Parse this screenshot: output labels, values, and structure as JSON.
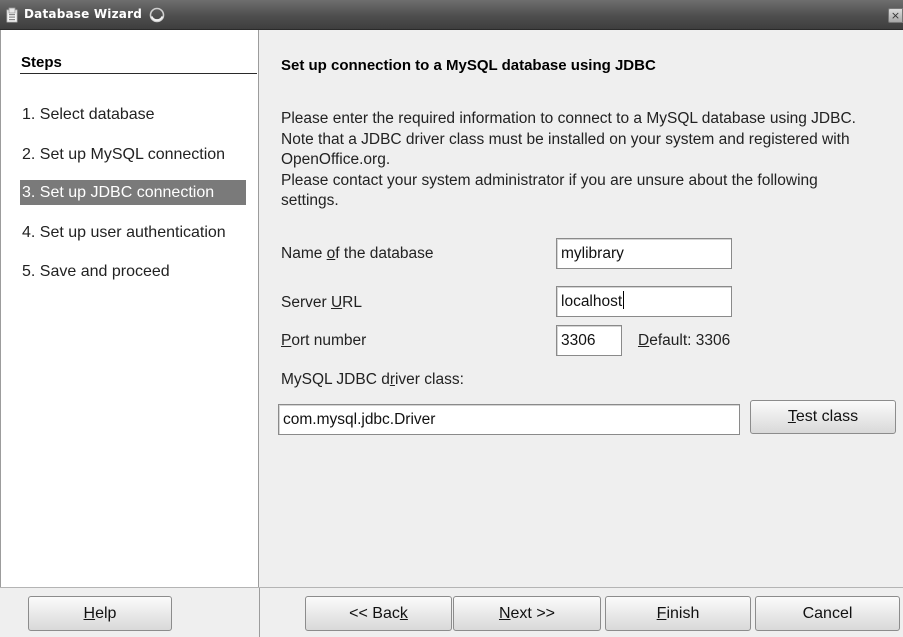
{
  "window": {
    "title": "Database Wizard"
  },
  "steps": {
    "heading": "Steps",
    "items": [
      {
        "label": "1. Select database",
        "active": false
      },
      {
        "label": "2. Set up MySQL connection",
        "active": false
      },
      {
        "label": "3. Set up JDBC connection",
        "active": true
      },
      {
        "label": "4. Set up user authentication",
        "active": false
      },
      {
        "label": "5. Save and proceed",
        "active": false
      }
    ]
  },
  "main": {
    "title": "Set up connection to a MySQL database using JDBC",
    "description": [
      "Please enter the required information to connect to a MySQL database using JDBC.",
      "Note that a JDBC driver class must be installed on your system and registered with",
      "OpenOffice.org.",
      "Please contact your system administrator if you are unsure about the following",
      "settings."
    ],
    "db_name": {
      "label_pre": "Name ",
      "label_acc": "o",
      "label_post": "f the database",
      "value": "mylibrary"
    },
    "server_url": {
      "label_pre": "Server ",
      "label_acc": "U",
      "label_post": "RL",
      "value": "localhost"
    },
    "port": {
      "label_pre": "",
      "label_acc": "P",
      "label_post": "ort number",
      "value": "3306",
      "default_pre": "",
      "default_acc": "D",
      "default_post": "efault: 3306"
    },
    "driver": {
      "label_pre": "MySQL JDBC d",
      "label_acc": "r",
      "label_post": "iver class:",
      "value": "com.mysql.jdbc.Driver"
    },
    "test_button": {
      "pre": "",
      "acc": "T",
      "post": "est class"
    }
  },
  "buttons": {
    "help": {
      "pre": "",
      "acc": "H",
      "post": "elp"
    },
    "back": {
      "pre": "<< Bac",
      "acc": "k",
      "post": ""
    },
    "next": {
      "pre": "",
      "acc": "N",
      "post": "ext >>"
    },
    "finish": {
      "pre": "",
      "acc": "F",
      "post": "inish"
    },
    "cancel": {
      "pre": "Cancel",
      "acc": "",
      "post": ""
    }
  },
  "icons": {
    "app": "database-wizard-icon",
    "busy": "busy-spinner-icon",
    "close": "close-icon"
  }
}
